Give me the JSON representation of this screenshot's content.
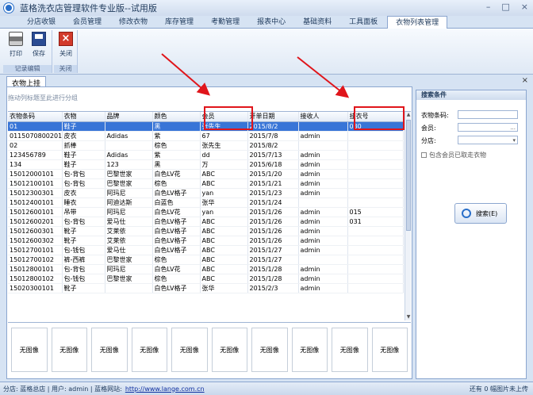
{
  "title": "蓝格洗衣店管理软件专业版--试用版",
  "window": {
    "min": "–",
    "max": "□",
    "close": "×"
  },
  "menu_tabs": [
    "分店收银",
    "会员管理",
    "修改衣物",
    "库存管理",
    "考勤管理",
    "报表中心",
    "基础资料",
    "工具面板",
    "衣物列表管理"
  ],
  "active_tab": 8,
  "ribbon": {
    "print": "打印",
    "save": "保存",
    "close": "关闭",
    "group1": "记录编辑",
    "group2": "关闭"
  },
  "doc_tab": "衣物上挂",
  "group_hint": "拖动列标题至此进行分组",
  "grid": {
    "columns": [
      "衣物条码",
      "衣物",
      "品牌",
      "颜色",
      "会员",
      "开单日期",
      "接收人",
      "挂衣号"
    ],
    "rows": [
      [
        "01",
        "鞋子",
        "",
        "黑",
        "张先生",
        "2015/8/2",
        "",
        "030"
      ],
      [
        "0115070800201",
        "皮衣",
        "Adidas",
        "紫",
        "67",
        "2015/7/8",
        "admin",
        ""
      ],
      [
        "02",
        "抓棒",
        "",
        "棕色",
        "张先生",
        "2015/8/2",
        "",
        ""
      ],
      [
        "123456789",
        "鞋子",
        "Adidas",
        "紫",
        "dd",
        "2015/7/13",
        "admin",
        ""
      ],
      [
        "134",
        "鞋子",
        "123",
        "黑",
        "万",
        "2015/6/18",
        "admin",
        ""
      ],
      [
        "15012000101",
        "包-背包",
        "巴黎世家",
        "白色LV花",
        "ABC",
        "2015/1/20",
        "admin",
        ""
      ],
      [
        "15012100101",
        "包-背包",
        "巴黎世家",
        "棕色",
        "ABC",
        "2015/1/21",
        "admin",
        ""
      ],
      [
        "15012300301",
        "皮衣",
        "阿玛尼",
        "白色LV格子",
        "yan",
        "2015/1/23",
        "admin",
        ""
      ],
      [
        "15012400101",
        "睡衣",
        "阿迪达斯",
        "白蓝色",
        "张华",
        "2015/1/24",
        "",
        ""
      ],
      [
        "15012600101",
        "吊带",
        "阿玛尼",
        "白色LV花",
        "yan",
        "2015/1/26",
        "admin",
        "015"
      ],
      [
        "15012600201",
        "包-背包",
        "爱马仕",
        "白色LV格子",
        "ABC",
        "2015/1/26",
        "admin",
        "031"
      ],
      [
        "15012600301",
        "靴子",
        "艾莱依",
        "白色LV格子",
        "ABC",
        "2015/1/26",
        "admin",
        ""
      ],
      [
        "15012600302",
        "靴子",
        "艾莱依",
        "白色LV格子",
        "ABC",
        "2015/1/26",
        "admin",
        ""
      ],
      [
        "15012700101",
        "包-钱包",
        "爱马仕",
        "白色LV格子",
        "ABC",
        "2015/1/27",
        "admin",
        ""
      ],
      [
        "15012700102",
        "裤-西裤",
        "巴黎世家",
        "棕色",
        "ABC",
        "2015/1/27",
        "",
        ""
      ],
      [
        "15012800101",
        "包-背包",
        "阿玛尼",
        "白色LV花",
        "ABC",
        "2015/1/28",
        "admin",
        ""
      ],
      [
        "15012800102",
        "包-钱包",
        "巴黎世家",
        "棕色",
        "ABC",
        "2015/1/28",
        "admin",
        ""
      ],
      [
        "15020300101",
        "靴子",
        "",
        "白色LV格子",
        "张华",
        "2015/2/3",
        "admin",
        ""
      ]
    ]
  },
  "thumbs": [
    "无图像",
    "无图像",
    "无图像",
    "无图像",
    "无图像",
    "无图像",
    "无图像",
    "无图像",
    "无图像",
    "无图像"
  ],
  "search": {
    "header": "搜索条件",
    "barcode_label": "衣物条码:",
    "member_label": "会员:",
    "branch_label": "分店:",
    "member_value": "...",
    "check_label": "包含会员已取走衣物",
    "button": "搜索(E)"
  },
  "status": {
    "text": "分店: 蓝格总店 | 用户: admin | 蓝格网站:",
    "url": "http://www.lange.com.cn",
    "right": "还有 0 幅图片未上传"
  }
}
